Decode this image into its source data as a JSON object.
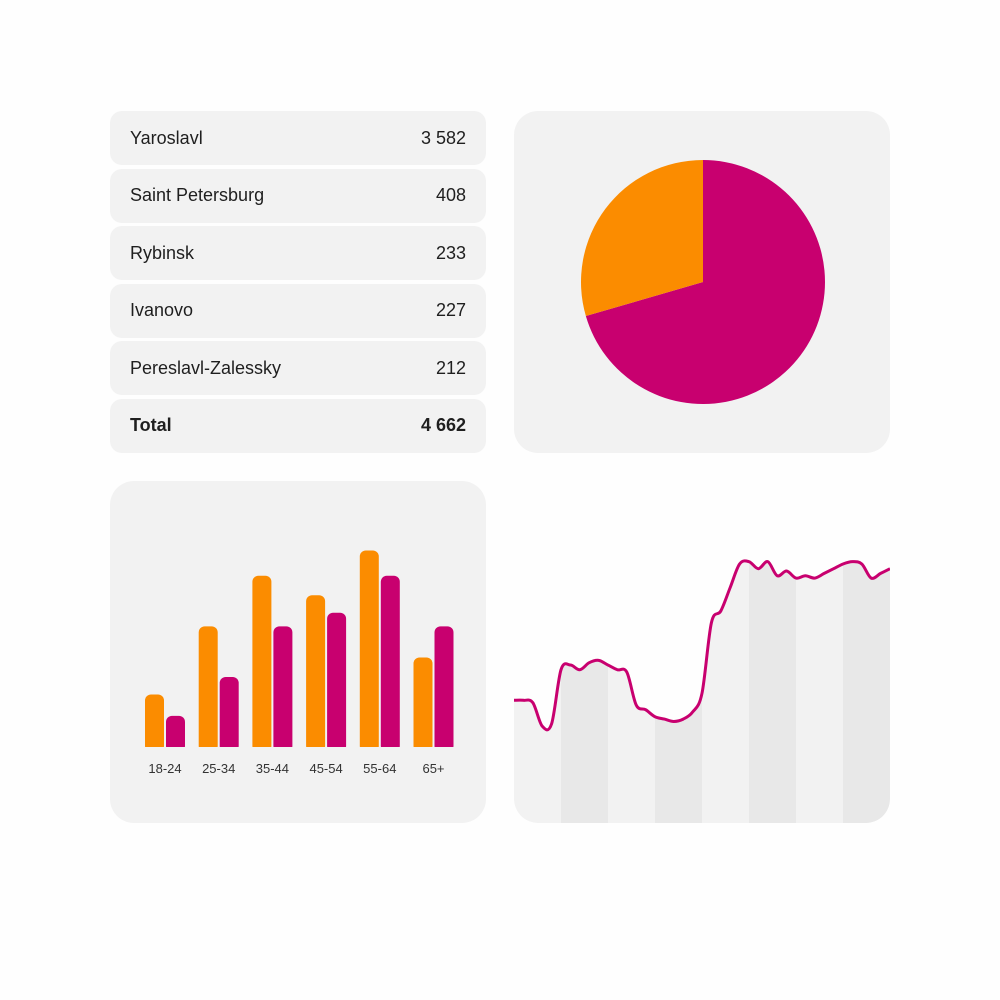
{
  "table": {
    "rows": [
      {
        "city": "Yaroslavl",
        "value": "3 582"
      },
      {
        "city": "Saint Petersburg",
        "value": "408"
      },
      {
        "city": "Rybinsk",
        "value": "233"
      },
      {
        "city": "Ivanovo",
        "value": "227"
      },
      {
        "city": "Pereslavl-Zalessky",
        "value": "212"
      }
    ],
    "total_label": "Total",
    "total_value": "4 662"
  },
  "colors": {
    "orange": "#fb8c00",
    "magenta": "#c8006f",
    "card": "#f2f2f2",
    "stripe": "#e8e8e8"
  },
  "chart_data": [
    {
      "type": "pie",
      "slices": [
        {
          "value": 70.5,
          "color": "#c8006f"
        },
        {
          "value": 29.5,
          "color": "#fb8c00"
        }
      ]
    },
    {
      "type": "bar",
      "categories": [
        "18-24",
        "25-34",
        "35-44",
        "45-54",
        "55-64",
        "65+"
      ],
      "series": [
        {
          "values": [
            27,
            62,
            88,
            78,
            101,
            46
          ],
          "color": "#fb8c00"
        },
        {
          "values": [
            16,
            36,
            62,
            69,
            88,
            62
          ],
          "color": "#c8006f"
        }
      ],
      "ylim": [
        0,
        110
      ]
    },
    {
      "type": "line",
      "x": [
        0,
        1,
        2,
        3,
        4,
        5,
        6,
        7,
        8,
        9,
        10,
        11,
        12,
        13,
        14,
        15,
        16,
        17,
        18,
        19,
        20,
        21,
        22,
        23,
        24,
        25,
        26,
        27,
        28,
        29,
        30,
        31,
        32,
        33,
        34,
        35,
        36,
        37,
        38,
        39,
        40
      ],
      "values": [
        42,
        42,
        41,
        31,
        32,
        55,
        57,
        55,
        58,
        59,
        57,
        55,
        54,
        40,
        38,
        35,
        34,
        33,
        34,
        37,
        45,
        75,
        80,
        90,
        100,
        101,
        98,
        101,
        95,
        97,
        94,
        95,
        94,
        96,
        98,
        100,
        101,
        100,
        94,
        96,
        98
      ],
      "ylim": [
        0,
        120
      ],
      "color": "#c8006f"
    }
  ]
}
